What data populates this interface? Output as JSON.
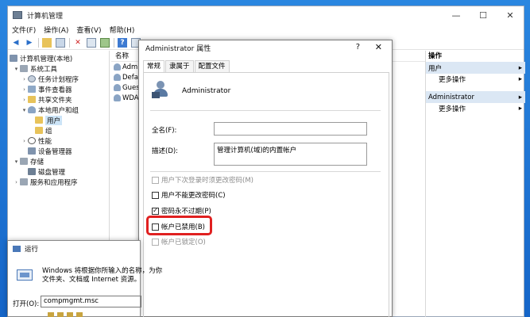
{
  "mmc": {
    "title": "计算机管理",
    "menu": [
      "文件(F)",
      "操作(A)",
      "查看(V)",
      "帮助(H)"
    ],
    "controls": {
      "minimize": "—",
      "maximize": "☐",
      "close": "✕"
    }
  },
  "tree": {
    "items": [
      {
        "label": "计算机管理(本地)",
        "level": 0,
        "twisty": ""
      },
      {
        "label": "系统工具",
        "level": 1,
        "twisty": "▾"
      },
      {
        "label": "任务计划程序",
        "level": 2,
        "twisty": "›"
      },
      {
        "label": "事件查看器",
        "level": 2,
        "twisty": "›"
      },
      {
        "label": "共享文件夹",
        "level": 2,
        "twisty": "›"
      },
      {
        "label": "本地用户和组",
        "level": 2,
        "twisty": "▾"
      },
      {
        "label": "用户",
        "level": 3,
        "twisty": "",
        "selected": true
      },
      {
        "label": "组",
        "level": 3,
        "twisty": ""
      },
      {
        "label": "性能",
        "level": 2,
        "twisty": "›"
      },
      {
        "label": "设备管理器",
        "level": 2,
        "twisty": ""
      },
      {
        "label": "存储",
        "level": 1,
        "twisty": "▾"
      },
      {
        "label": "磁盘管理",
        "level": 2,
        "twisty": ""
      },
      {
        "label": "服务和应用程序",
        "level": 1,
        "twisty": "›"
      }
    ]
  },
  "list": {
    "header": "名称",
    "rows": [
      "Admi",
      "Defa",
      "Gues",
      "WDA"
    ]
  },
  "actions": {
    "header": "操作",
    "sections": [
      {
        "title": "用户",
        "item": "更多操作"
      },
      {
        "title": "Administrator",
        "item": "更多操作"
      }
    ],
    "arrow": "▸"
  },
  "dialog": {
    "title": "Administrator 属性",
    "help": "?",
    "close": "✕",
    "tabs": [
      "常规",
      "隶属于",
      "配置文件"
    ],
    "username": "Administrator",
    "fullname_label": "全名(F):",
    "fullname_value": "",
    "desc_label": "描述(D):",
    "desc_value": "管理计算机(域)的内置帐户",
    "checkboxes": [
      {
        "label": "用户下次登录时须更改密码(M)",
        "checked": false,
        "disabled": true
      },
      {
        "label": "用户不能更改密码(C)",
        "checked": false,
        "disabled": false
      },
      {
        "label": "密码永不过期(P)",
        "checked": true,
        "disabled": false
      },
      {
        "label": "帐户已禁用(B)",
        "checked": false,
        "disabled": false
      },
      {
        "label": "帐户已锁定(O)",
        "checked": false,
        "disabled": true
      }
    ],
    "check_mark": "✓"
  },
  "run": {
    "title": "运行",
    "desc1": "Windows 将根据你所输入的名称，为你",
    "desc2": "文件夹、文档或 Internet 资源。",
    "open_label": "打开(O):",
    "input_value": "compmgmt.msc"
  },
  "colors": {
    "highlight": "#e02020",
    "selection": "#cce4f7",
    "action_section": "#dbe7f4"
  }
}
